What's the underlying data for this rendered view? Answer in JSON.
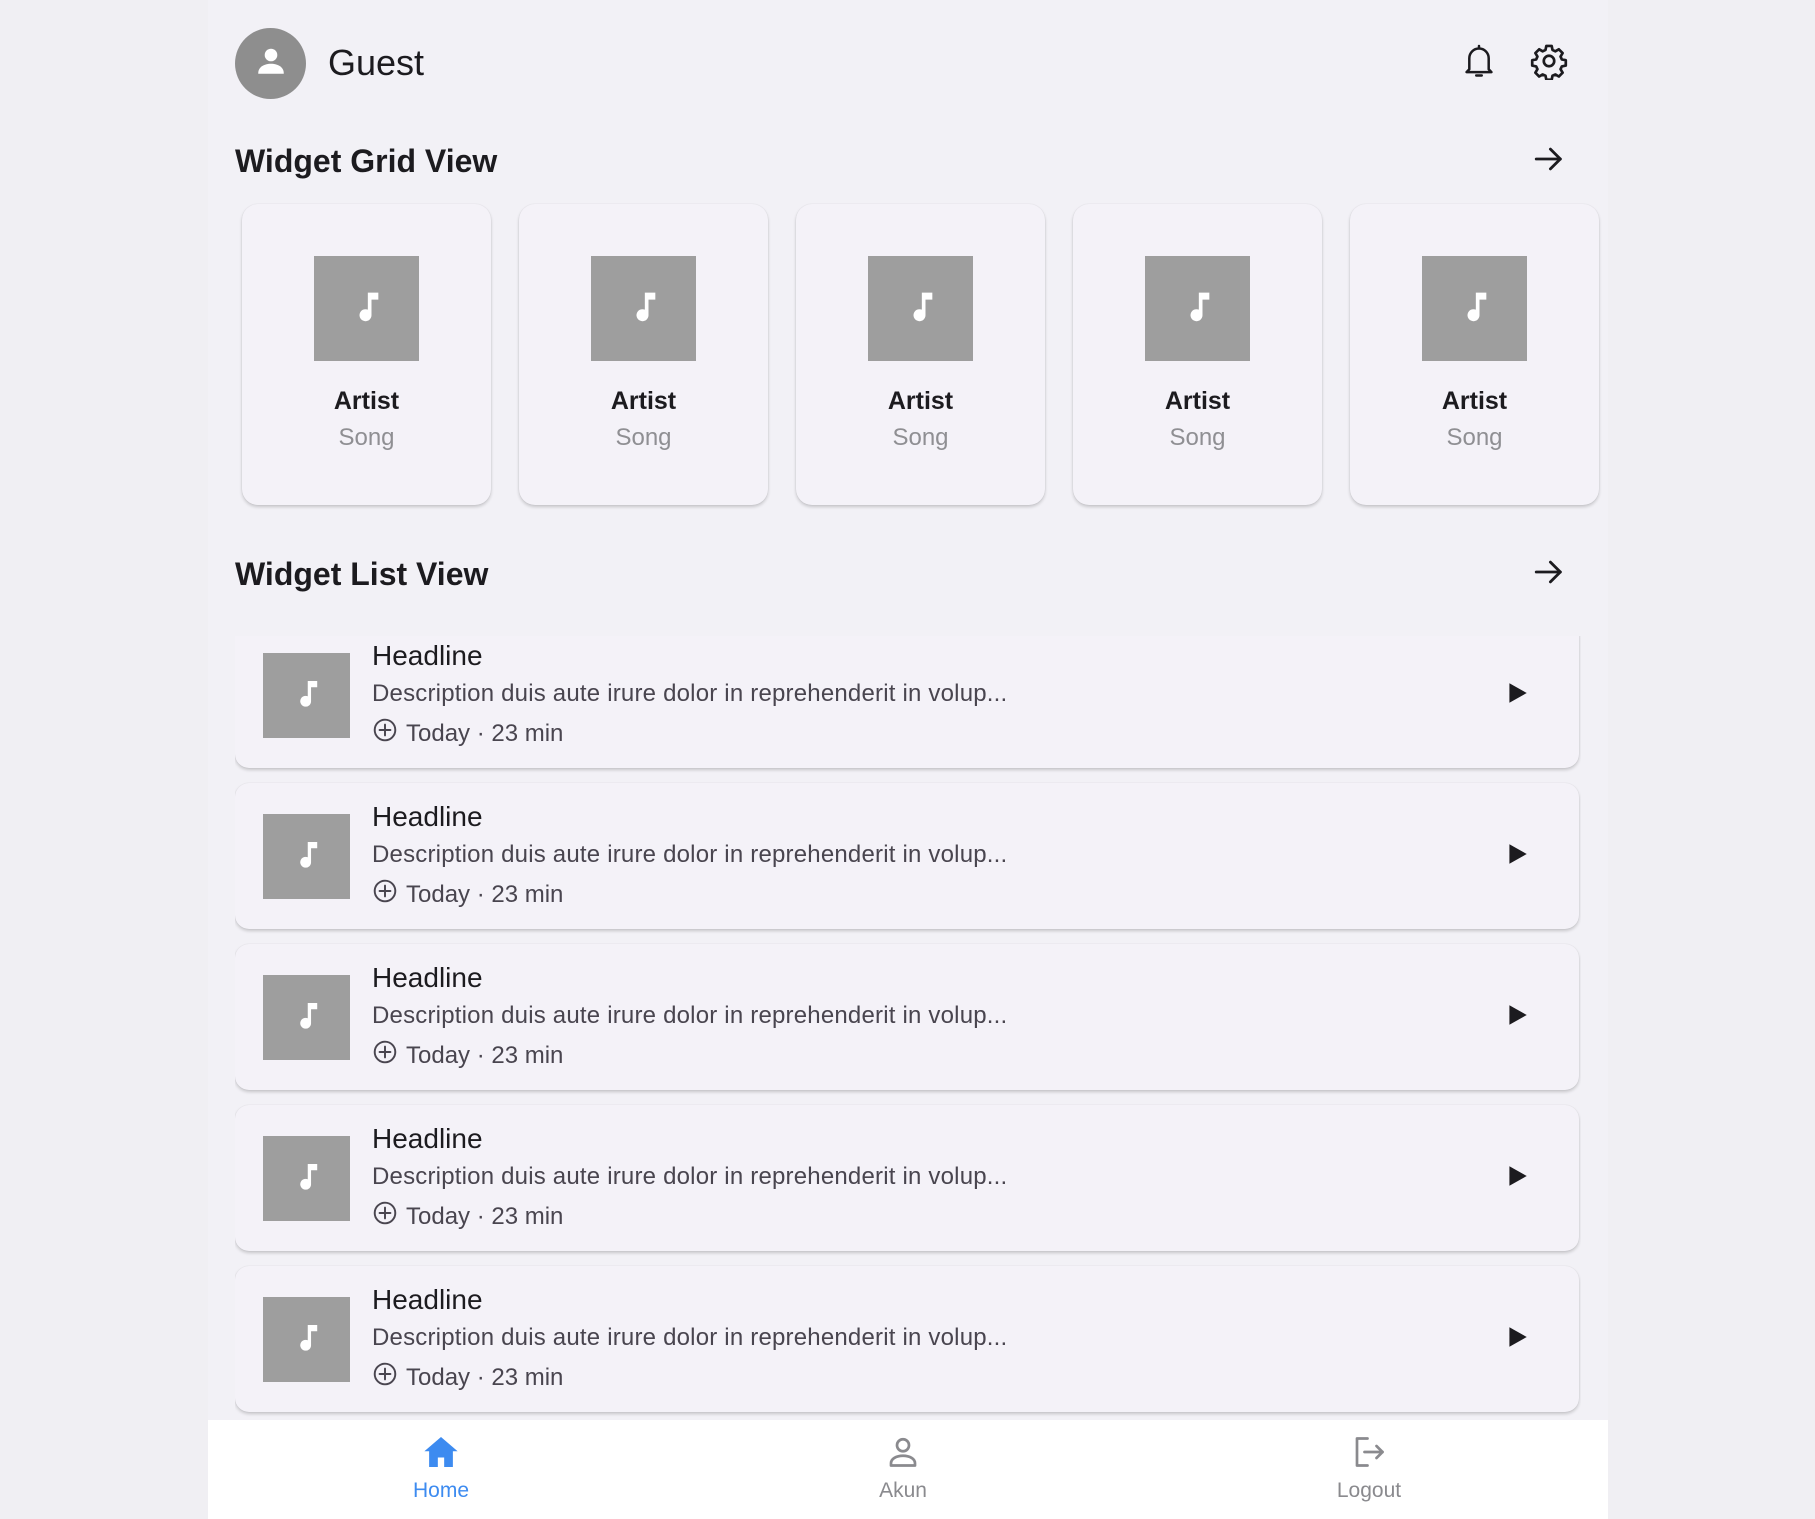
{
  "header": {
    "user_name": "Guest",
    "avatar_icon": "person-icon",
    "notifications_icon": "bell-icon",
    "settings_icon": "gear-icon"
  },
  "grid_section": {
    "title": "Widget Grid View",
    "more_icon": "arrow-right-icon",
    "items": [
      {
        "artist": "Artist",
        "song": "Song",
        "icon": "music-note-icon"
      },
      {
        "artist": "Artist",
        "song": "Song",
        "icon": "music-note-icon"
      },
      {
        "artist": "Artist",
        "song": "Song",
        "icon": "music-note-icon"
      },
      {
        "artist": "Artist",
        "song": "Song",
        "icon": "music-note-icon"
      },
      {
        "artist": "Artist",
        "song": "Song",
        "icon": "music-note-icon"
      }
    ]
  },
  "list_section": {
    "title": "Widget List View",
    "more_icon": "arrow-right-icon",
    "items": [
      {
        "headline": "Headline",
        "description": "Description duis aute irure dolor in reprehenderit in volup...",
        "meta": "Today · 23 min",
        "icon": "music-note-icon"
      },
      {
        "headline": "Headline",
        "description": "Description duis aute irure dolor in reprehenderit in volup...",
        "meta": "Today · 23 min",
        "icon": "music-note-icon"
      },
      {
        "headline": "Headline",
        "description": "Description duis aute irure dolor in reprehenderit in volup...",
        "meta": "Today · 23 min",
        "icon": "music-note-icon"
      },
      {
        "headline": "Headline",
        "description": "Description duis aute irure dolor in reprehenderit in volup...",
        "meta": "Today · 23 min",
        "icon": "music-note-icon"
      },
      {
        "headline": "Headline",
        "description": "Description duis aute irure dolor in reprehenderit in volup...",
        "meta": "Today · 23 min",
        "icon": "music-note-icon"
      }
    ]
  },
  "bottom_nav": {
    "active_color": "#3d8bf0",
    "inactive_color": "#8a8a8e",
    "items": [
      {
        "label": "Home",
        "icon": "home-icon",
        "active": true
      },
      {
        "label": "Akun",
        "icon": "person-outline-icon",
        "active": false
      },
      {
        "label": "Logout",
        "icon": "logout-icon",
        "active": false
      }
    ]
  },
  "colors": {
    "page_background": "#f0eff3",
    "surface": "#f4f2f8",
    "thumbnail": "#9e9e9e",
    "avatar": "#8e8e8e"
  }
}
